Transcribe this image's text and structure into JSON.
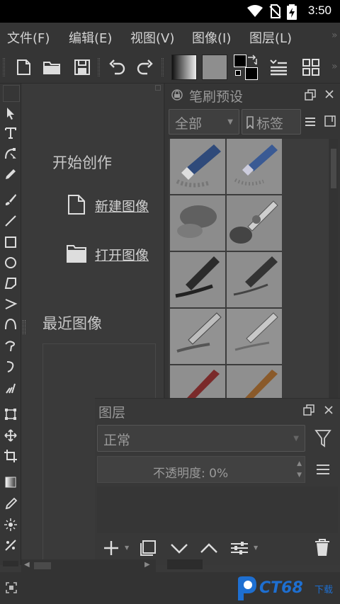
{
  "status_bar": {
    "time": "3:50"
  },
  "menubar": {
    "items": [
      {
        "label": "文件(F)"
      },
      {
        "label": "编辑(E)"
      },
      {
        "label": "视图(V)"
      },
      {
        "label": "图像(I)"
      },
      {
        "label": "图层(L)"
      }
    ]
  },
  "welcome": {
    "start_heading": "开始创作",
    "new_image": "新建图像",
    "open_image": "打开图像",
    "recent_heading": "最近图像"
  },
  "brush_presets": {
    "title": "笔刷预设",
    "filter_value": "全部",
    "tag_label": "标签"
  },
  "layers": {
    "title": "图层",
    "blend_mode": "正常",
    "opacity_label": "不透明度:  0%"
  },
  "watermark": {
    "text": "CT68",
    "suffix": "下载"
  },
  "colors": {
    "background": "#393939",
    "panel": "#353535",
    "text": "#c8c8c8",
    "watermark_blue": "#1e6fd1"
  }
}
